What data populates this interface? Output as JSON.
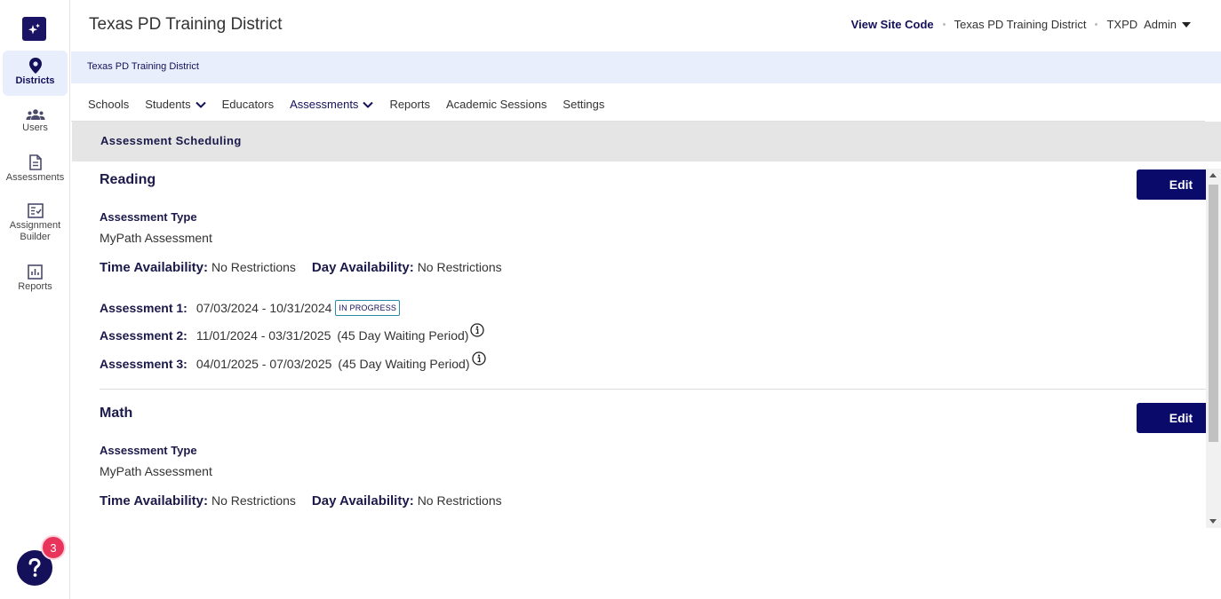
{
  "header": {
    "title": "Texas PD Training District",
    "view_site_code": "View Site Code",
    "district": "Texas PD Training District",
    "user_code": "TXPD",
    "user_role": "Admin"
  },
  "sidebar": {
    "items": [
      {
        "label": "Districts",
        "icon": "location-pin-icon",
        "active": true
      },
      {
        "label": "Users",
        "icon": "users-icon"
      },
      {
        "label": "Assessments",
        "icon": "document-icon"
      },
      {
        "label": "Assignment Builder",
        "icon": "checklist-icon"
      },
      {
        "label": "Reports",
        "icon": "bar-chart-icon"
      }
    ],
    "help_badge": "3"
  },
  "breadcrumb": "Texas PD Training District",
  "tabs": [
    {
      "label": "Schools"
    },
    {
      "label": "Students",
      "dropdown": true
    },
    {
      "label": "Educators"
    },
    {
      "label": "Assessments",
      "dropdown": true,
      "active": true
    },
    {
      "label": "Reports"
    },
    {
      "label": "Academic Sessions"
    },
    {
      "label": "Settings"
    }
  ],
  "section_title": "Assessment Scheduling",
  "subjects": [
    {
      "name": "Reading",
      "edit_label": "Edit",
      "type_label": "Assessment Type",
      "type_value": "MyPath Assessment",
      "time_label": "Time Availability:",
      "time_value": "No Restrictions",
      "day_label": "Day Availability:",
      "day_value": "No Restrictions",
      "assessments": [
        {
          "label": "Assessment 1:",
          "dates": "07/03/2024 - 10/31/2024",
          "status": "IN PROGRESS"
        },
        {
          "label": "Assessment 2:",
          "dates": "11/01/2024 - 03/31/2025",
          "note": "(45 Day Waiting Period)"
        },
        {
          "label": "Assessment 3:",
          "dates": "04/01/2025 - 07/03/2025",
          "note": "(45 Day Waiting Period)"
        }
      ]
    },
    {
      "name": "Math",
      "edit_label": "Edit",
      "type_label": "Assessment Type",
      "type_value": "MyPath Assessment",
      "time_label": "Time Availability:",
      "time_value": "No Restrictions",
      "day_label": "Day Availability:",
      "day_value": "No Restrictions"
    }
  ],
  "colors": {
    "brand": "#14105a",
    "button": "#0a0a6b",
    "breadcrumb_bg": "#e8eefc",
    "badge": "#e8335b"
  }
}
